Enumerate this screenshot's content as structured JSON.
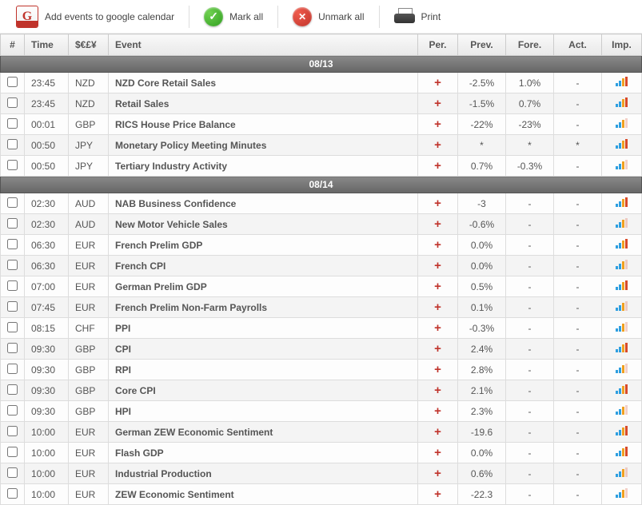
{
  "toolbar": {
    "google": "Add events to google calendar",
    "mark_all": "Mark all",
    "unmark_all": "Unmark all",
    "print": "Print"
  },
  "headers": {
    "num": "#",
    "time": "Time",
    "currency": "$€£¥",
    "event": "Event",
    "per": "Per.",
    "prev": "Prev.",
    "fore": "Fore.",
    "act": "Act.",
    "imp": "Imp."
  },
  "groups": [
    {
      "date": "08/13",
      "rows": [
        {
          "time": "23:45",
          "cur": "NZD",
          "event": "NZD Core Retail Sales",
          "prev": "-2.5%",
          "fore": "1.0%",
          "act": "-",
          "imp": 3
        },
        {
          "time": "23:45",
          "cur": "NZD",
          "event": "Retail Sales",
          "prev": "-1.5%",
          "fore": "0.7%",
          "act": "-",
          "imp": 3
        },
        {
          "time": "00:01",
          "cur": "GBP",
          "event": "RICS House Price Balance",
          "prev": "-22%",
          "fore": "-23%",
          "act": "-",
          "imp": 2
        },
        {
          "time": "00:50",
          "cur": "JPY",
          "event": "Monetary Policy Meeting Minutes",
          "prev": "*",
          "fore": "*",
          "act": "*",
          "imp": 3
        },
        {
          "time": "00:50",
          "cur": "JPY",
          "event": "Tertiary Industry Activity",
          "prev": "0.7%",
          "fore": "-0.3%",
          "act": "-",
          "imp": 2
        }
      ]
    },
    {
      "date": "08/14",
      "rows": [
        {
          "time": "02:30",
          "cur": "AUD",
          "event": "NAB Business Confidence",
          "prev": "-3",
          "fore": "-",
          "act": "-",
          "imp": 3
        },
        {
          "time": "02:30",
          "cur": "AUD",
          "event": "New Motor Vehicle Sales",
          "prev": "-0.6%",
          "fore": "-",
          "act": "-",
          "imp": 2
        },
        {
          "time": "06:30",
          "cur": "EUR",
          "event": "French Prelim GDP",
          "prev": "0.0%",
          "fore": "-",
          "act": "-",
          "imp": 3
        },
        {
          "time": "06:30",
          "cur": "EUR",
          "event": "French CPI",
          "prev": "0.0%",
          "fore": "-",
          "act": "-",
          "imp": 2
        },
        {
          "time": "07:00",
          "cur": "EUR",
          "event": "German Prelim GDP",
          "prev": "0.5%",
          "fore": "-",
          "act": "-",
          "imp": 3
        },
        {
          "time": "07:45",
          "cur": "EUR",
          "event": "French Prelim Non-Farm Payrolls",
          "prev": "0.1%",
          "fore": "-",
          "act": "-",
          "imp": 2
        },
        {
          "time": "08:15",
          "cur": "CHF",
          "event": "PPI",
          "prev": "-0.3%",
          "fore": "-",
          "act": "-",
          "imp": 2
        },
        {
          "time": "09:30",
          "cur": "GBP",
          "event": "CPI",
          "prev": "2.4%",
          "fore": "-",
          "act": "-",
          "imp": 3
        },
        {
          "time": "09:30",
          "cur": "GBP",
          "event": "RPI",
          "prev": "2.8%",
          "fore": "-",
          "act": "-",
          "imp": 2
        },
        {
          "time": "09:30",
          "cur": "GBP",
          "event": "Core CPI",
          "prev": "2.1%",
          "fore": "-",
          "act": "-",
          "imp": 3
        },
        {
          "time": "09:30",
          "cur": "GBP",
          "event": "HPI",
          "prev": "2.3%",
          "fore": "-",
          "act": "-",
          "imp": 2
        },
        {
          "time": "10:00",
          "cur": "EUR",
          "event": "German ZEW Economic Sentiment",
          "prev": "-19.6",
          "fore": "-",
          "act": "-",
          "imp": 3
        },
        {
          "time": "10:00",
          "cur": "EUR",
          "event": "Flash GDP",
          "prev": "0.0%",
          "fore": "-",
          "act": "-",
          "imp": 3
        },
        {
          "time": "10:00",
          "cur": "EUR",
          "event": "Industrial Production",
          "prev": "0.6%",
          "fore": "-",
          "act": "-",
          "imp": 2
        },
        {
          "time": "10:00",
          "cur": "EUR",
          "event": "ZEW Economic Sentiment",
          "prev": "-22.3",
          "fore": "-",
          "act": "-",
          "imp": 2
        }
      ]
    }
  ]
}
